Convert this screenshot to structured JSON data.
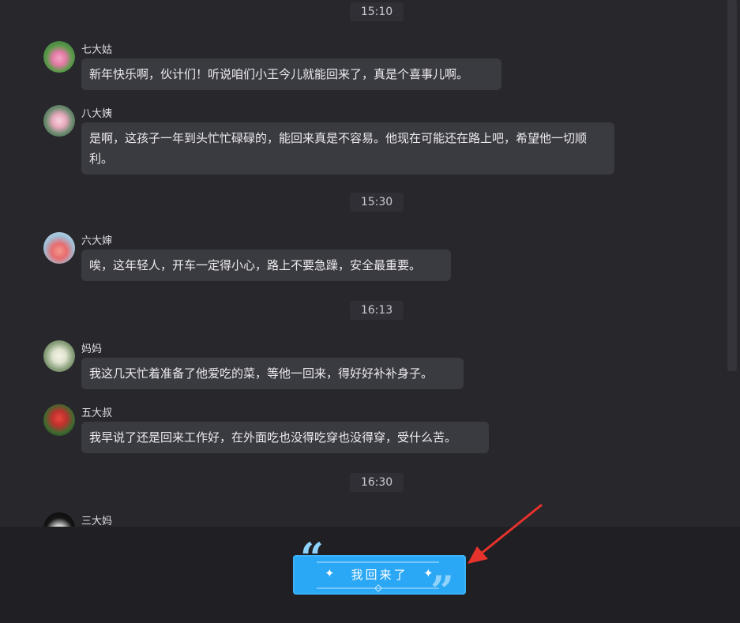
{
  "chat": {
    "groups": [
      {
        "time": "15:10"
      },
      {
        "time": "15:30"
      },
      {
        "time": "16:13"
      },
      {
        "time": "16:30"
      }
    ],
    "messages": [
      {
        "name": "七大姑",
        "text": "新年快乐啊，伙计们！听说咱们小王今儿就能回来了，真是个喜事儿啊。"
      },
      {
        "name": "八大姨",
        "text": "是啊，这孩子一年到头忙忙碌碌的，能回来真是不容易。他现在可能还在路上吧，希望他一切顺利。"
      },
      {
        "name": "六大婶",
        "text": "唉，这年轻人，开车一定得小心，路上不要急躁，安全最重要。"
      },
      {
        "name": "妈妈",
        "text": "我这几天忙着准备了他爱吃的菜，等他一回来，得好好补补身子。"
      },
      {
        "name": "五大叔",
        "text": "我早说了还是回来工作好，在外面吃也没得吃穿也没得穿，受什么苦。"
      },
      {
        "name": "三大妈",
        "text": ""
      }
    ]
  },
  "sticker": {
    "text": "我回来了"
  },
  "colors": {
    "background": "#27272c",
    "bubble": "#3a3a41",
    "sticker": "#2aa7f5",
    "arrow": "#e8322c"
  },
  "icons": [
    "lotus-avatar-icon",
    "sparkle-icon",
    "quote-icon",
    "annotation-arrow-icon"
  ]
}
